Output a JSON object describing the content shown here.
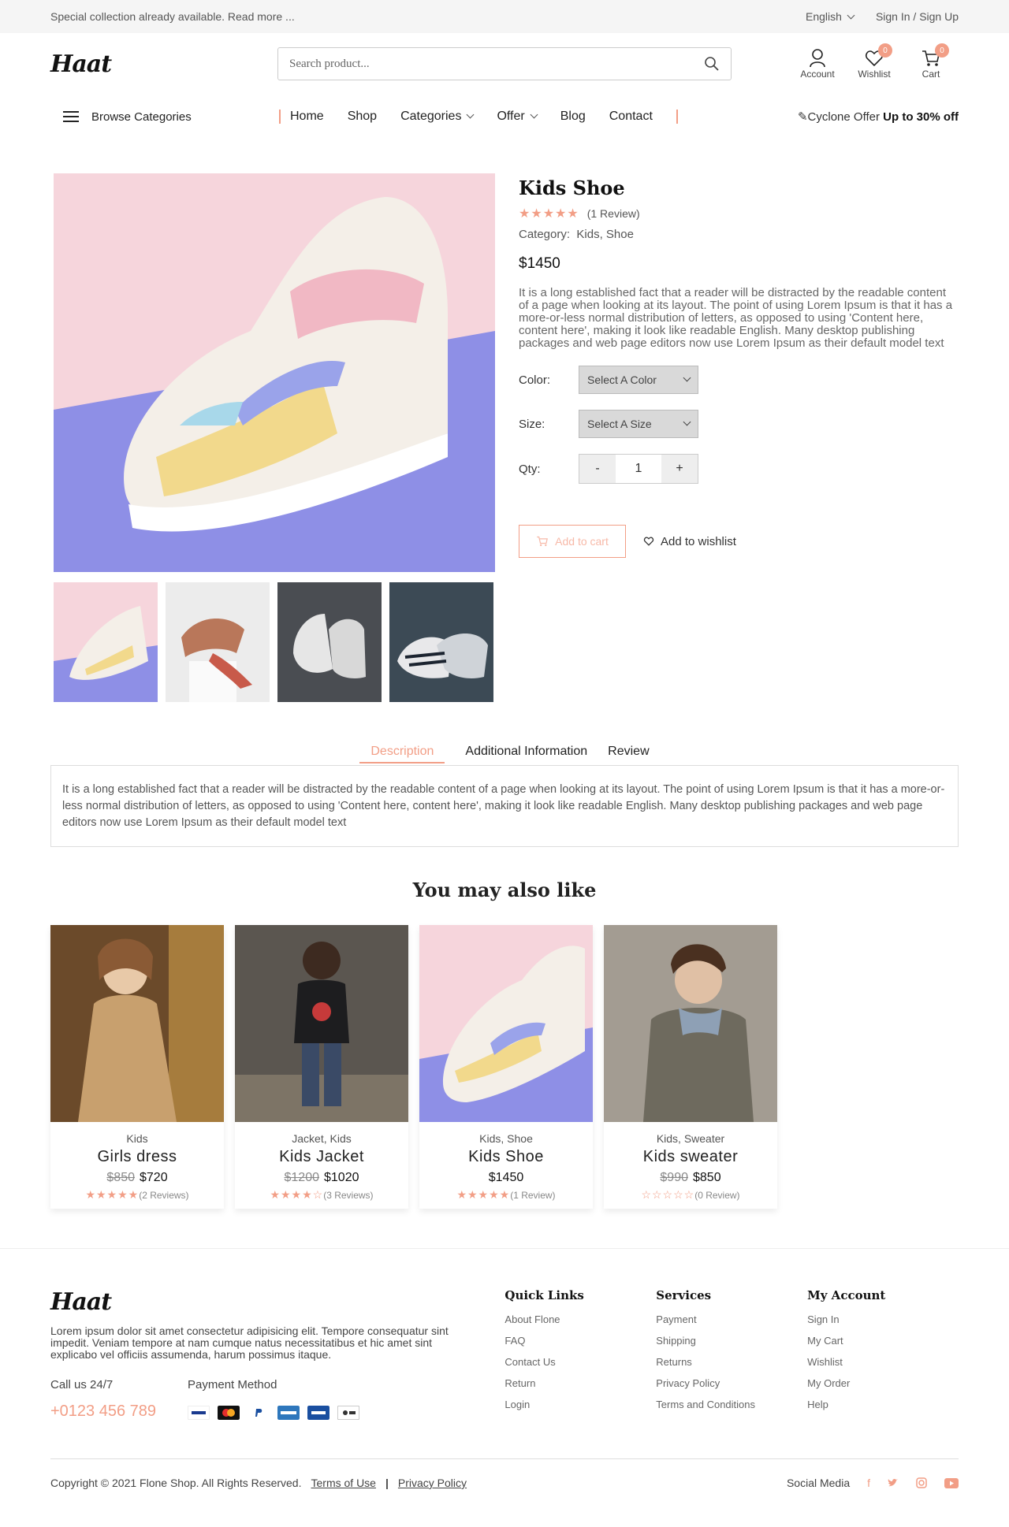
{
  "topbar": {
    "promo": "Special collection already available. Read more ...",
    "language": "English",
    "auth": "Sign In / Sign Up"
  },
  "header": {
    "logo": "Haat",
    "search_placeholder": "Search product...",
    "account_label": "Account",
    "wishlist_label": "Wishlist",
    "wishlist_count": "0",
    "cart_label": "Cart",
    "cart_count": "0"
  },
  "nav": {
    "browse": "Browse Categories",
    "items": [
      "Home",
      "Shop",
      "Categories",
      "Offer",
      "Blog",
      "Contact"
    ],
    "offer_prefix": "Cyclone Offer",
    "offer_bold": "Up to 30% off"
  },
  "product": {
    "title": "Kids Shoe",
    "reviews": "(1 Review)",
    "category_label": "Category:",
    "category_value": "Kids, Shoe",
    "price": "$1450",
    "description": "It is a long established fact that a reader will be distracted by the readable content of a page when looking at its layout. The point of using Lorem Ipsum is that it has a more-or-less normal distribution of letters, as opposed to using 'Content here, content here', making it look like readable English. Many desktop publishing packages and web page editors now use Lorem Ipsum as their default model text",
    "color_label": "Color:",
    "color_value": "Select A Color",
    "size_label": "Size:",
    "size_value": "Select A Size",
    "qty_label": "Qty:",
    "qty_minus": "-",
    "qty_value": "1",
    "qty_plus": "+",
    "add_to_cart": "Add to cart",
    "add_to_wishlist": "Add to wishlist"
  },
  "tabs": {
    "items": [
      "Description",
      "Additional Information",
      "Review"
    ],
    "content": "It is a long established fact that a reader will be distracted by the readable content of a page when looking at its layout. The point of using Lorem Ipsum is that it has a more-or-less normal distribution of letters, as opposed to using 'Content here, content here', making it look like readable English. Many desktop publishing packages and web page editors now use Lorem Ipsum as their default model text"
  },
  "related": {
    "title": "You may also like",
    "cards": [
      {
        "category": "Kids",
        "name": "Girls dress",
        "old_price": "$850",
        "price": "$720",
        "reviews": "(2 Reviews)",
        "rating": 5
      },
      {
        "category": "Jacket, Kids",
        "name": "Kids Jacket",
        "old_price": "$1200",
        "price": "$1020",
        "reviews": "(3 Reviews)",
        "rating": 4
      },
      {
        "category": "Kids, Shoe",
        "name": "Kids Shoe",
        "old_price": "",
        "price": "$1450",
        "reviews": "(1 Review)",
        "rating": 5
      },
      {
        "category": "Kids, Sweater",
        "name": "Kids sweater",
        "old_price": "$990",
        "price": "$850",
        "reviews": "(0 Review)",
        "rating": 0
      }
    ]
  },
  "footer": {
    "logo": "Haat",
    "about": "Lorem ipsum dolor sit amet consectetur adipisicing elit. Tempore consequatur sint impedit. Veniam tempore at nam cumque natus necessitatibus et hic amet sint explicabo vel officiis assumenda, harum possimus itaque.",
    "call_label": "Call us 24/7",
    "payment_label": "Payment Method",
    "phone": "+0123 456 789",
    "quick_links": {
      "title": "Quick Links",
      "items": [
        "About Flone",
        "FAQ",
        "Contact Us",
        "Return",
        "Login"
      ]
    },
    "services": {
      "title": "Services",
      "items": [
        "Payment",
        "Shipping",
        "Returns",
        "Privacy Policy",
        "Terms and Conditions"
      ]
    },
    "account": {
      "title": "My Account",
      "items": [
        "Sign In",
        "My Cart",
        "Wishlist",
        "My Order",
        "Help"
      ]
    },
    "copyright": "Copyright © 2021 Flone Shop. All Rights Reserved.",
    "terms": "Terms of Use",
    "divider": "|",
    "privacy": "Privacy Policy",
    "social_label": "Social Media"
  },
  "colors": {
    "accent": "#f29e86"
  }
}
